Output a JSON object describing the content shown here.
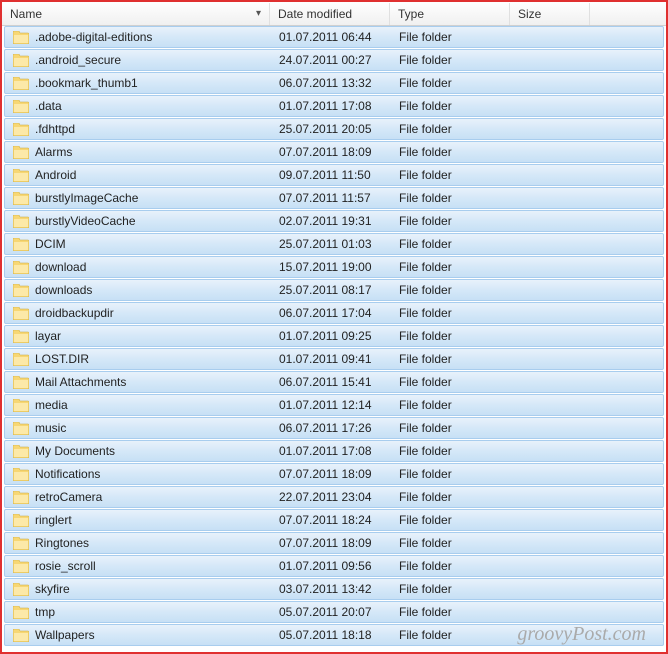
{
  "columns": {
    "name": "Name",
    "date": "Date modified",
    "type": "Type",
    "size": "Size"
  },
  "files": [
    {
      "name": ".adobe-digital-editions",
      "date": "01.07.2011 06:44",
      "type": "File folder",
      "size": ""
    },
    {
      "name": ".android_secure",
      "date": "24.07.2011 00:27",
      "type": "File folder",
      "size": ""
    },
    {
      "name": ".bookmark_thumb1",
      "date": "06.07.2011 13:32",
      "type": "File folder",
      "size": ""
    },
    {
      "name": ".data",
      "date": "01.07.2011 17:08",
      "type": "File folder",
      "size": ""
    },
    {
      "name": ".fdhttpd",
      "date": "25.07.2011 20:05",
      "type": "File folder",
      "size": ""
    },
    {
      "name": "Alarms",
      "date": "07.07.2011 18:09",
      "type": "File folder",
      "size": ""
    },
    {
      "name": "Android",
      "date": "09.07.2011 11:50",
      "type": "File folder",
      "size": ""
    },
    {
      "name": "burstlyImageCache",
      "date": "07.07.2011 11:57",
      "type": "File folder",
      "size": ""
    },
    {
      "name": "burstlyVideoCache",
      "date": "02.07.2011 19:31",
      "type": "File folder",
      "size": ""
    },
    {
      "name": "DCIM",
      "date": "25.07.2011 01:03",
      "type": "File folder",
      "size": ""
    },
    {
      "name": "download",
      "date": "15.07.2011 19:00",
      "type": "File folder",
      "size": ""
    },
    {
      "name": "downloads",
      "date": "25.07.2011 08:17",
      "type": "File folder",
      "size": ""
    },
    {
      "name": "droidbackupdir",
      "date": "06.07.2011 17:04",
      "type": "File folder",
      "size": ""
    },
    {
      "name": "layar",
      "date": "01.07.2011 09:25",
      "type": "File folder",
      "size": ""
    },
    {
      "name": "LOST.DIR",
      "date": "01.07.2011 09:41",
      "type": "File folder",
      "size": ""
    },
    {
      "name": "Mail Attachments",
      "date": "06.07.2011 15:41",
      "type": "File folder",
      "size": ""
    },
    {
      "name": "media",
      "date": "01.07.2011 12:14",
      "type": "File folder",
      "size": ""
    },
    {
      "name": "music",
      "date": "06.07.2011 17:26",
      "type": "File folder",
      "size": ""
    },
    {
      "name": "My Documents",
      "date": "01.07.2011 17:08",
      "type": "File folder",
      "size": ""
    },
    {
      "name": "Notifications",
      "date": "07.07.2011 18:09",
      "type": "File folder",
      "size": ""
    },
    {
      "name": "retroCamera",
      "date": "22.07.2011 23:04",
      "type": "File folder",
      "size": ""
    },
    {
      "name": "ringlert",
      "date": "07.07.2011 18:24",
      "type": "File folder",
      "size": ""
    },
    {
      "name": "Ringtones",
      "date": "07.07.2011 18:09",
      "type": "File folder",
      "size": ""
    },
    {
      "name": "rosie_scroll",
      "date": "01.07.2011 09:56",
      "type": "File folder",
      "size": ""
    },
    {
      "name": "skyfire",
      "date": "03.07.2011 13:42",
      "type": "File folder",
      "size": ""
    },
    {
      "name": "tmp",
      "date": "05.07.2011 20:07",
      "type": "File folder",
      "size": ""
    },
    {
      "name": "Wallpapers",
      "date": "05.07.2011 18:18",
      "type": "File folder",
      "size": ""
    }
  ],
  "watermark": "groovyPost.com"
}
